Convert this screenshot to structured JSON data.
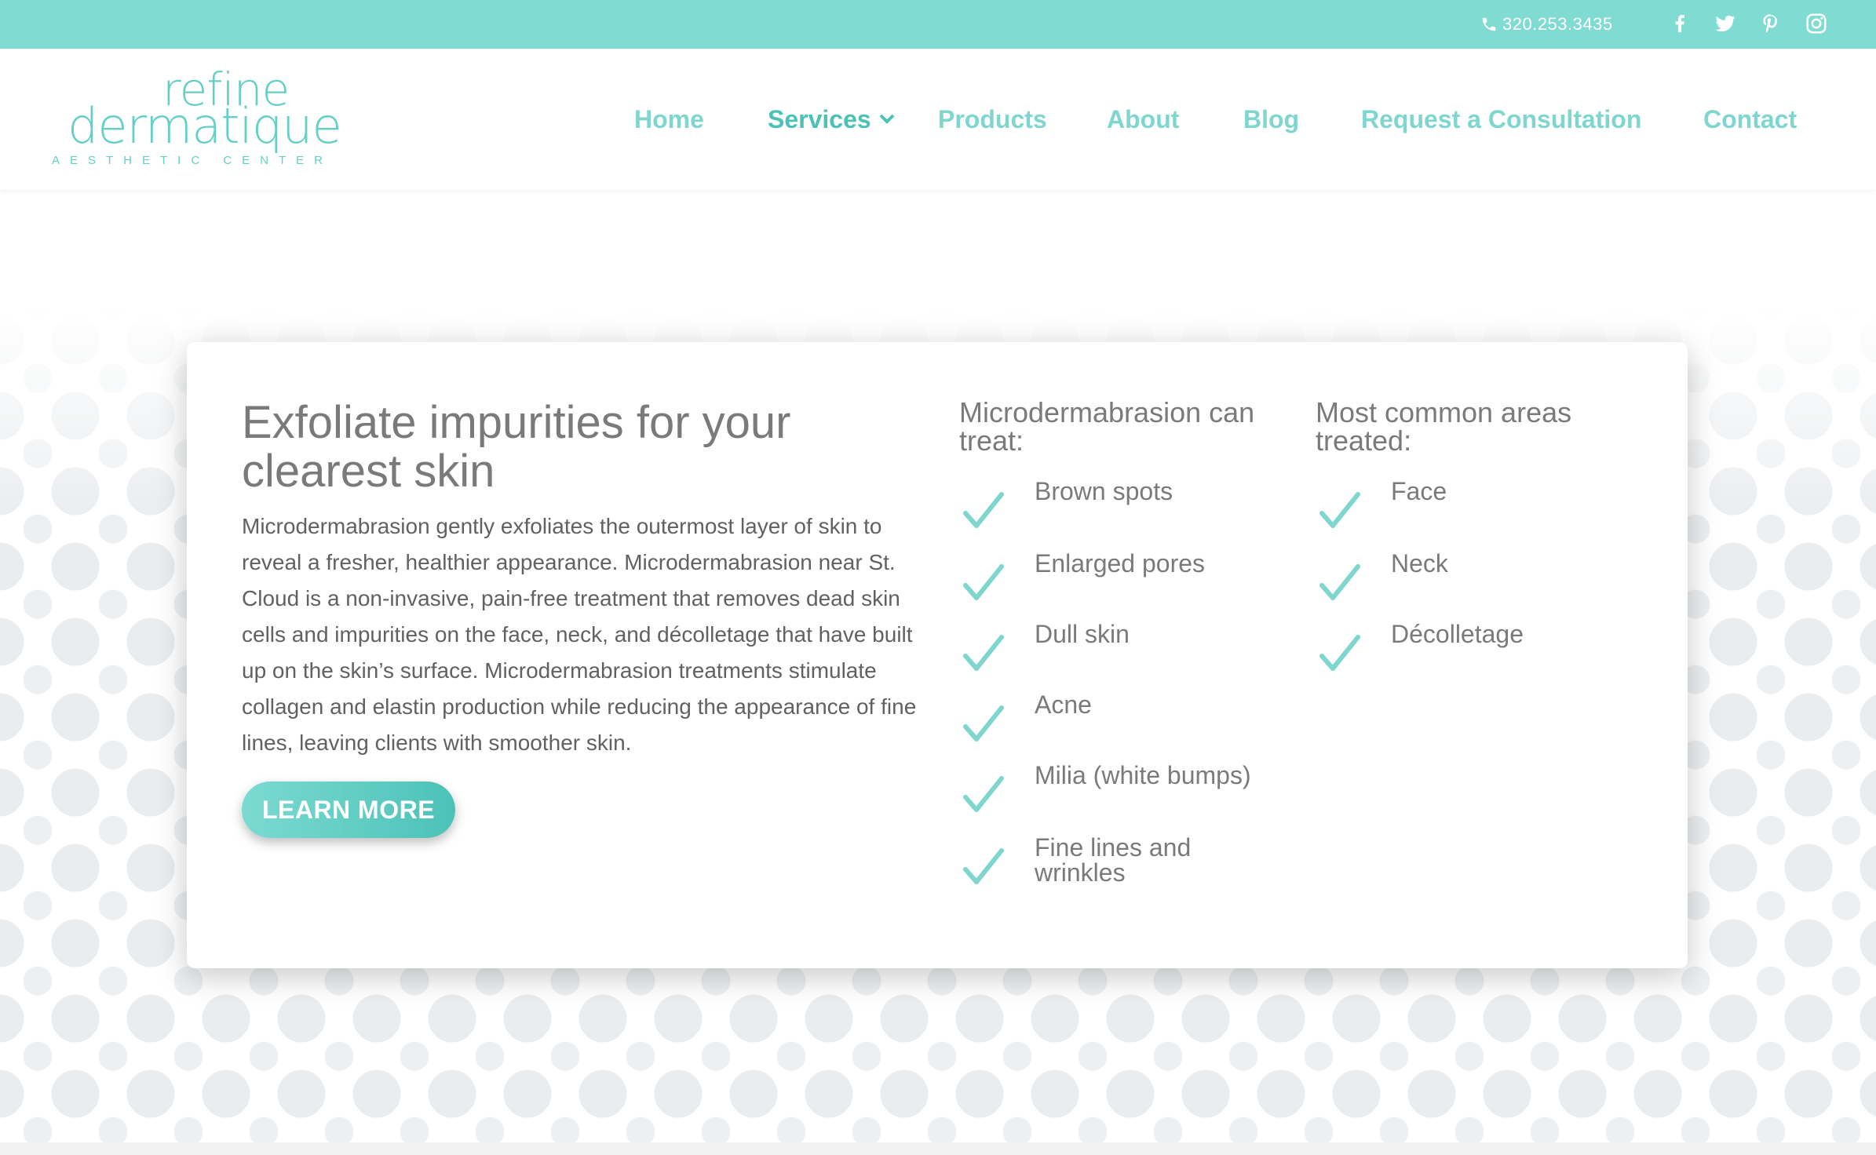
{
  "topbar": {
    "phone": "320.253.3435",
    "social_icons": [
      "facebook-icon",
      "twitter-icon",
      "pinterest-icon",
      "instagram-icon"
    ],
    "color": "#80dbd3"
  },
  "logo": {
    "line1": "refine",
    "line2": "dermatique",
    "tagline": "AESTHETIC CENTER"
  },
  "nav": {
    "items": [
      {
        "label": "Home"
      },
      {
        "label": "Services",
        "has_dropdown": true,
        "active": true
      },
      {
        "label": "Products"
      },
      {
        "label": "About"
      },
      {
        "label": "Blog"
      },
      {
        "label": "Request a Consultation"
      },
      {
        "label": "Contact"
      }
    ]
  },
  "card": {
    "heading": "Exfoliate impurities for your clearest skin",
    "description": "Microdermabrasion gently exfoliates the outermost layer of skin to reveal a fresher, healthier appearance. Microdermabrasion near St. Cloud is a non-invasive, pain-free treatment that removes dead skin cells and impurities on the face, neck, and décolletage that have built up on the skin’s surface. Microdermabrasion treatments stimulate collagen and elastin production while reducing the appearance of fine lines, leaving clients with smoother skin.",
    "button_label": "LEARN MORE",
    "treats": {
      "heading": "Microdermabrasion can treat:",
      "items": [
        "Brown spots",
        "Enlarged pores",
        "Dull skin",
        "Acne",
        "Milia (white bumps)",
        "Fine lines and wrinkles"
      ]
    },
    "areas": {
      "heading": "Most common areas treated:",
      "items": [
        "Face",
        "Neck",
        "Décolletage"
      ]
    }
  },
  "colors": {
    "accent": "#7fd6cf",
    "accent_dark": "#4cc2b7",
    "text_gray": "#7a7a7a"
  }
}
